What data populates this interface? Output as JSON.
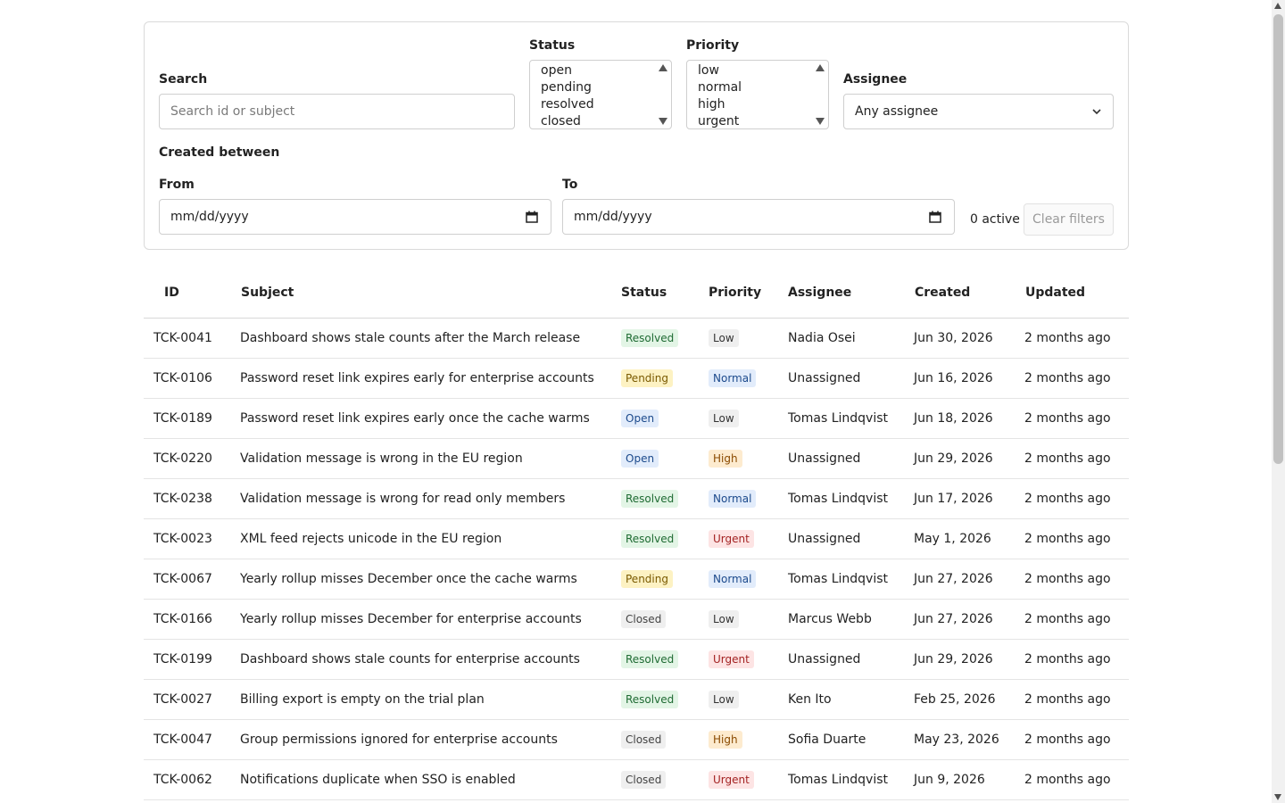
{
  "filters": {
    "search": {
      "label": "Search",
      "placeholder": "Search id or subject",
      "value": ""
    },
    "status": {
      "label": "Status",
      "options": [
        "open",
        "pending",
        "resolved",
        "closed"
      ]
    },
    "priority": {
      "label": "Priority",
      "options": [
        "low",
        "normal",
        "high",
        "urgent"
      ]
    },
    "assignee": {
      "label": "Assignee",
      "selected": "Any assignee"
    },
    "created_between": {
      "label": "Created between",
      "from": {
        "label": "From",
        "value": "mm/dd/yyyy"
      },
      "to": {
        "label": "To",
        "value": "mm/dd/yyyy"
      }
    },
    "active_count": "0 active",
    "clear_label": "Clear filters"
  },
  "table": {
    "headers": [
      "ID",
      "Subject",
      "Status",
      "Priority",
      "Assignee",
      "Created",
      "Updated"
    ],
    "rows": [
      {
        "id": "TCK-0041",
        "subject": "Dashboard shows stale counts after the March release",
        "status": "Resolved",
        "priority": "Low",
        "assignee": "Nadia Osei",
        "created": "Jun 30, 2026",
        "updated": "2 months ago"
      },
      {
        "id": "TCK-0106",
        "subject": "Password reset link expires early for enterprise accounts",
        "status": "Pending",
        "priority": "Normal",
        "assignee": "Unassigned",
        "created": "Jun 16, 2026",
        "updated": "2 months ago"
      },
      {
        "id": "TCK-0189",
        "subject": "Password reset link expires early once the cache warms",
        "status": "Open",
        "priority": "Low",
        "assignee": "Tomas Lindqvist",
        "created": "Jun 18, 2026",
        "updated": "2 months ago"
      },
      {
        "id": "TCK-0220",
        "subject": "Validation message is wrong in the EU region",
        "status": "Open",
        "priority": "High",
        "assignee": "Unassigned",
        "created": "Jun 29, 2026",
        "updated": "2 months ago"
      },
      {
        "id": "TCK-0238",
        "subject": "Validation message is wrong for read only members",
        "status": "Resolved",
        "priority": "Normal",
        "assignee": "Tomas Lindqvist",
        "created": "Jun 17, 2026",
        "updated": "2 months ago"
      },
      {
        "id": "TCK-0023",
        "subject": "XML feed rejects unicode in the EU region",
        "status": "Resolved",
        "priority": "Urgent",
        "assignee": "Unassigned",
        "created": "May 1, 2026",
        "updated": "2 months ago"
      },
      {
        "id": "TCK-0067",
        "subject": "Yearly rollup misses December once the cache warms",
        "status": "Pending",
        "priority": "Normal",
        "assignee": "Tomas Lindqvist",
        "created": "Jun 27, 2026",
        "updated": "2 months ago"
      },
      {
        "id": "TCK-0166",
        "subject": "Yearly rollup misses December for enterprise accounts",
        "status": "Closed",
        "priority": "Low",
        "assignee": "Marcus Webb",
        "created": "Jun 27, 2026",
        "updated": "2 months ago"
      },
      {
        "id": "TCK-0199",
        "subject": "Dashboard shows stale counts for enterprise accounts",
        "status": "Resolved",
        "priority": "Urgent",
        "assignee": "Unassigned",
        "created": "Jun 29, 2026",
        "updated": "2 months ago"
      },
      {
        "id": "TCK-0027",
        "subject": "Billing export is empty on the trial plan",
        "status": "Resolved",
        "priority": "Low",
        "assignee": "Ken Ito",
        "created": "Feb 25, 2026",
        "updated": "2 months ago"
      },
      {
        "id": "TCK-0047",
        "subject": "Group permissions ignored for enterprise accounts",
        "status": "Closed",
        "priority": "High",
        "assignee": "Sofia Duarte",
        "created": "May 23, 2026",
        "updated": "2 months ago"
      },
      {
        "id": "TCK-0062",
        "subject": "Notifications duplicate when SSO is enabled",
        "status": "Closed",
        "priority": "Urgent",
        "assignee": "Tomas Lindqvist",
        "created": "Jun 9, 2026",
        "updated": "2 months ago"
      }
    ]
  },
  "icons": {
    "assignee_dropdown": "chevron-down-icon",
    "date_picker": "calendar-icon"
  }
}
